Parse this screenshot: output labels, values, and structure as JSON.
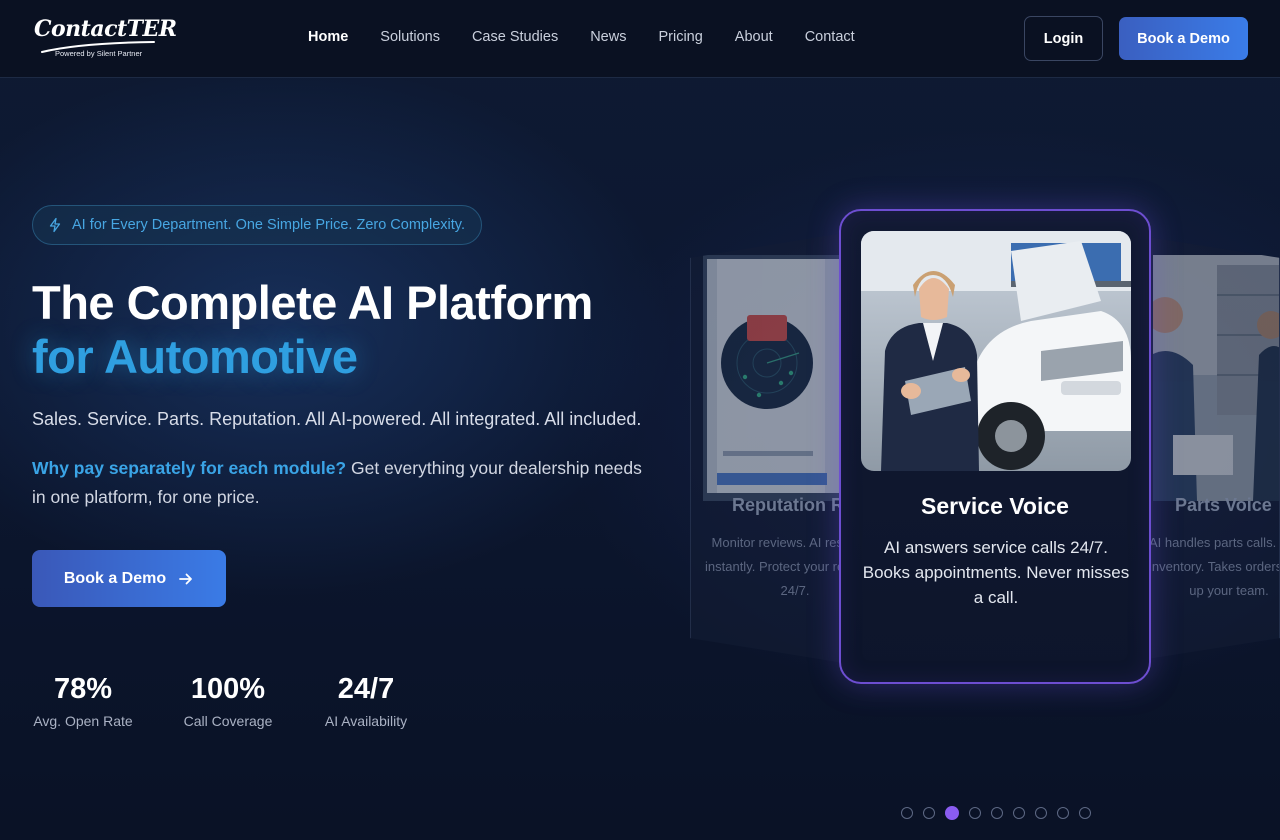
{
  "logo": {
    "wordmark": "ContactTER",
    "tagline": "Powered by Silent Partner"
  },
  "nav": {
    "links": [
      {
        "label": "Home",
        "active": true
      },
      {
        "label": "Solutions",
        "active": false
      },
      {
        "label": "Case Studies",
        "active": false
      },
      {
        "label": "News",
        "active": false
      },
      {
        "label": "Pricing",
        "active": false
      },
      {
        "label": "About",
        "active": false
      },
      {
        "label": "Contact",
        "active": false
      }
    ],
    "login_label": "Login",
    "demo_label": "Book a Demo"
  },
  "hero": {
    "badge_icon": "lightning-icon",
    "badge_text": "AI for Every Department. One Simple Price. Zero Complexity.",
    "title_line1": "The Complete AI Platform",
    "title_line2": "for Automotive",
    "subtitle": "Sales. Service. Parts. Reputation. All AI-powered. All integrated. All included.",
    "desc_highlight": "Why pay separately for each module?",
    "desc_rest": "Get everything your dealership needs in one platform, for one price.",
    "cta_label": "Book a Demo",
    "cta_icon": "arrow-right-icon",
    "stats": [
      {
        "value": "78%",
        "label": "Avg. Open Rate"
      },
      {
        "value": "100%",
        "label": "Call Coverage"
      },
      {
        "value": "24/7",
        "label": "AI Availability"
      }
    ]
  },
  "carousel": {
    "left_card": {
      "title": "Reputation Radar",
      "desc_lines": [
        "Monitor reviews. AI responds",
        "instantly. Protect your reputation",
        "24/7."
      ]
    },
    "main_card": {
      "title": "Service Voice",
      "desc": "AI answers service calls 24/7. Books appointments. Never misses a call."
    },
    "right_card": {
      "title": "Parts Voice",
      "desc_lines": [
        "AI handles parts calls. Checks",
        "inventory. Takes orders. Frees",
        "up your team."
      ]
    },
    "dot_count": 9,
    "active_dot": 2
  },
  "colors": {
    "accent_blue": "#2f9fe0",
    "button_gradient_start": "#3a58b8",
    "button_gradient_end": "#3a7be6",
    "active_dot": "#8a5cf0",
    "card_border": "#6d4ed1"
  }
}
